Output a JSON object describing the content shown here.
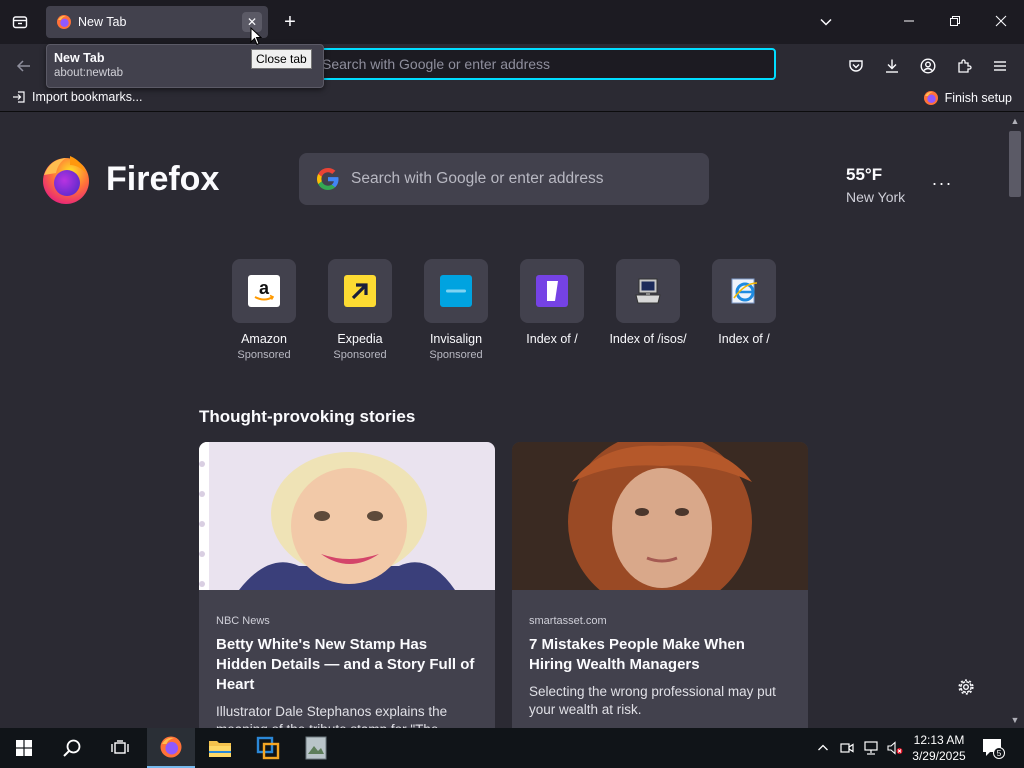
{
  "tab": {
    "title": "New Tab",
    "close_glyph": "✕"
  },
  "new_tab_glyph": "+",
  "tab_preview": {
    "title": "New Tab",
    "url": "about:newtab"
  },
  "tooltip": "Close tab",
  "urlbar": {
    "placeholder": "Search with Google or enter address"
  },
  "bookmarks": {
    "import": "Import bookmarks...",
    "finish": "Finish setup"
  },
  "logo": {
    "wordmark": "Firefox"
  },
  "search": {
    "placeholder": "Search with Google or enter address"
  },
  "weather": {
    "temp": "55°F",
    "location": "New York",
    "menu": "···"
  },
  "shortcuts": [
    {
      "name": "Amazon",
      "sponsored": "Sponsored",
      "icon": "amazon-icon"
    },
    {
      "name": "Expedia",
      "sponsored": "Sponsored",
      "icon": "expedia-icon"
    },
    {
      "name": "Invisalign",
      "sponsored": "Sponsored",
      "icon": "invisalign-icon"
    },
    {
      "name": "Index of /",
      "sponsored": "",
      "icon": "index-page-icon"
    },
    {
      "name": "Index of /isos/",
      "sponsored": "",
      "icon": "computer-icon"
    },
    {
      "name": "Index of /",
      "sponsored": "",
      "icon": "internet-explorer-icon"
    }
  ],
  "stories": {
    "title": "Thought-provoking stories",
    "cards": [
      {
        "source": "NBC News",
        "headline": "Betty White's New Stamp Has Hidden Details — and a Story Full of Heart",
        "excerpt": "Illustrator Dale Stephanos explains the meaning of the tribute stamp for \"The Golden Girls\" star."
      },
      {
        "source": "smartasset.com",
        "headline": "7 Mistakes People Make When Hiring Wealth Managers",
        "excerpt": "Selecting the wrong professional may put your wealth at risk."
      }
    ]
  },
  "taskbar": {
    "time": "12:13 AM",
    "date": "3/29/2025",
    "notifications": "5"
  },
  "colors": {
    "accent": "#00ddff",
    "background": "#2b2a33",
    "card": "#42414d",
    "firefox_orange": "#ff7139",
    "firefox_purple": "#9059ff"
  }
}
